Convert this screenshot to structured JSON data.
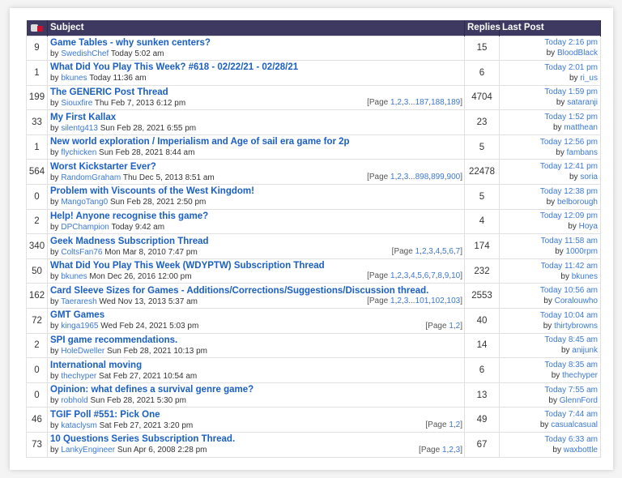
{
  "header": {
    "thumb_icon": "thumbs-icon",
    "subject": "Subject",
    "replies": "Replies",
    "last_post": "Last Post"
  },
  "colors": {
    "header_bg": "#3d3960",
    "link": "#1a5fc4"
  },
  "rows": [
    {
      "thumbs": "9",
      "title": "Game Tables - why sunken centers?",
      "author": "SwedishChef",
      "date": "Today 5:02 am",
      "pages": [],
      "replies": "15",
      "last_time": "Today 2:16 pm",
      "last_by": "BloodBlack"
    },
    {
      "thumbs": "1",
      "title": "What Did You Play This Week? #618 - 02/22/21 - 02/28/21",
      "author": "bkunes",
      "date": "Today 11:36 am",
      "pages": [],
      "replies": "6",
      "last_time": "Today 2:01 pm",
      "last_by": "ri_us"
    },
    {
      "thumbs": "199",
      "title": "The GENERIC Post Thread",
      "author": "Siouxfire",
      "date": "Thu Feb 7, 2013 6:12 pm",
      "pages": [
        "1",
        "2",
        "3",
        "...",
        "187",
        "188",
        "189"
      ],
      "replies": "4704",
      "last_time": "Today 1:59 pm",
      "last_by": "sataranji"
    },
    {
      "thumbs": "33",
      "title": "My First Kallax",
      "author": "silentg413",
      "date": "Sun Feb 28, 2021 6:55 pm",
      "pages": [],
      "replies": "23",
      "last_time": "Today 1:52 pm",
      "last_by": "matthean"
    },
    {
      "thumbs": "1",
      "title": "New world exploration / Imperialism and Age of sail era game for 2p",
      "author": "flychicken",
      "date": "Sun Feb 28, 2021 8:44 am",
      "pages": [],
      "replies": "5",
      "last_time": "Today 12:56 pm",
      "last_by": "fambans"
    },
    {
      "thumbs": "564",
      "title": "Worst Kickstarter Ever?",
      "author": "RandomGraham",
      "date": "Thu Dec 5, 2013 8:51 am",
      "pages": [
        "1",
        "2",
        "3",
        "...",
        "898",
        "899",
        "900"
      ],
      "replies": "22478",
      "last_time": "Today 12:41 pm",
      "last_by": "soria"
    },
    {
      "thumbs": "0",
      "title": "Problem with Viscounts of the West Kingdom!",
      "author": "MangoTang0",
      "date": "Sun Feb 28, 2021 2:50 pm",
      "pages": [],
      "replies": "5",
      "last_time": "Today 12:38 pm",
      "last_by": "belborough"
    },
    {
      "thumbs": "2",
      "title": "Help! Anyone recognise this game?",
      "author": "DPChampion",
      "date": "Today 9:42 am",
      "pages": [],
      "replies": "4",
      "last_time": "Today 12:09 pm",
      "last_by": "Hoya"
    },
    {
      "thumbs": "340",
      "title": "Geek Madness Subscription Thread",
      "author": "ColtsFan76",
      "date": "Mon Mar 8, 2010 7:47 pm",
      "pages": [
        "1",
        "2",
        "3",
        "4",
        "5",
        "6",
        "7"
      ],
      "replies": "174",
      "last_time": "Today 11:58 am",
      "last_by": "1000rpm"
    },
    {
      "thumbs": "50",
      "title": "What Did You Play This Week (WDYPTW) Subscription Thread",
      "author": "bkunes",
      "date": "Mon Dec 26, 2016 12:00 pm",
      "pages": [
        "1",
        "2",
        "3",
        "4",
        "5",
        "6",
        "7",
        "8",
        "9",
        "10"
      ],
      "replies": "232",
      "last_time": "Today 11:42 am",
      "last_by": "bkunes"
    },
    {
      "thumbs": "162",
      "title": "Card Sleeve Sizes for Games - Additions/Corrections/Suggestions/Discussion thread.",
      "author": "Taeraresh",
      "date": "Wed Nov 13, 2013 5:37 am",
      "pages": [
        "1",
        "2",
        "3",
        "...",
        "101",
        "102",
        "103"
      ],
      "replies": "2553",
      "last_time": "Today 10:56 am",
      "last_by": "Coralouwho"
    },
    {
      "thumbs": "72",
      "title": "GMT Games",
      "author": "kinga1965",
      "date": "Wed Feb 24, 2021 5:03 pm",
      "pages": [
        "1",
        "2"
      ],
      "replies": "40",
      "last_time": "Today 10:04 am",
      "last_by": "thirtybrowns"
    },
    {
      "thumbs": "2",
      "title": "SPI game recommendations.",
      "author": "HoleDweller",
      "date": "Sun Feb 28, 2021 10:13 pm",
      "pages": [],
      "replies": "14",
      "last_time": "Today 8:45 am",
      "last_by": "anijunk"
    },
    {
      "thumbs": "0",
      "title": "International moving",
      "author": "thechyper",
      "date": "Sat Feb 27, 2021 10:54 am",
      "pages": [],
      "replies": "6",
      "last_time": "Today 8:35 am",
      "last_by": "thechyper"
    },
    {
      "thumbs": "0",
      "title": "Opinion: what defines a survival genre game?",
      "author": "robhold",
      "date": "Sun Feb 28, 2021 5:30 pm",
      "pages": [],
      "replies": "13",
      "last_time": "Today 7:55 am",
      "last_by": "GlennFord"
    },
    {
      "thumbs": "46",
      "title": "TGIF Poll #551: Pick One",
      "author": "kataclysm",
      "date": "Sat Feb 27, 2021 3:20 pm",
      "pages": [
        "1",
        "2"
      ],
      "replies": "49",
      "last_time": "Today 7:44 am",
      "last_by": "casualcasual"
    },
    {
      "thumbs": "73",
      "title": "10 Questions Series Subscription Thread.",
      "author": "LankyEngineer",
      "date": "Sun Apr 6, 2008 2:28 pm",
      "pages": [
        "1",
        "2",
        "3"
      ],
      "replies": "67",
      "last_time": "Today 6:33 am",
      "last_by": "waxbottle"
    }
  ],
  "labels": {
    "by": "by ",
    "page_prefix": "[Page ",
    "page_suffix": "]"
  }
}
